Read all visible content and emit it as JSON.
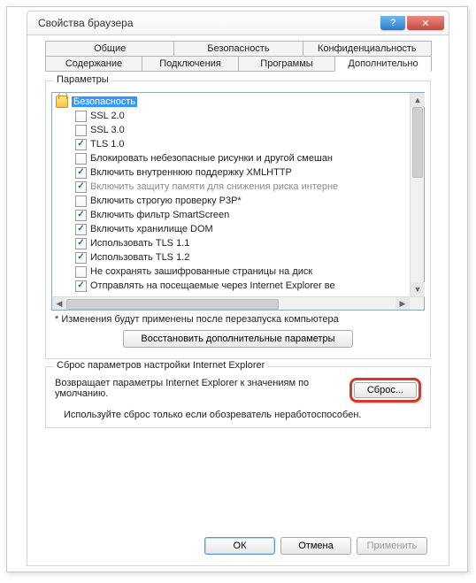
{
  "window": {
    "title": "Свойства браузера",
    "help_glyph": "?",
    "close_glyph": "✕"
  },
  "tabs_row1": [
    {
      "label": "Общие"
    },
    {
      "label": "Безопасность"
    },
    {
      "label": "Конфиденциальность"
    }
  ],
  "tabs_row2": [
    {
      "label": "Содержание"
    },
    {
      "label": "Подключения"
    },
    {
      "label": "Программы"
    },
    {
      "label": "Дополнительно",
      "active": true
    }
  ],
  "params": {
    "legend": "Параметры",
    "category": "Безопасность",
    "items": [
      {
        "label": "SSL 2.0",
        "checked": false
      },
      {
        "label": "SSL 3.0",
        "checked": false
      },
      {
        "label": "TLS 1.0",
        "checked": true
      },
      {
        "label": "Блокировать небезопасные рисунки и другой смешан",
        "checked": false
      },
      {
        "label": "Включить внутреннюю поддержку XMLHTTP",
        "checked": true
      },
      {
        "label": "Включить защиту памяти для снижения риска интерне",
        "checked": true,
        "disabled": true
      },
      {
        "label": "Включить строгую проверку P3P*",
        "checked": false
      },
      {
        "label": "Включить фильтр SmartScreen",
        "checked": true
      },
      {
        "label": "Включить хранилище DOM",
        "checked": true
      },
      {
        "label": "Использовать TLS 1.1",
        "checked": true
      },
      {
        "label": "Использовать TLS 1.2",
        "checked": true
      },
      {
        "label": "Не сохранять зашифрованные страницы на диск",
        "checked": false
      },
      {
        "label": "Отправлять на посещаемые через Internet Explorer ве",
        "checked": true
      }
    ],
    "note": "* Изменения будут применены после перезапуска компьютера",
    "restore_btn": "Восстановить дополнительные параметры"
  },
  "reset": {
    "legend": "Сброс параметров настройки Internet Explorer",
    "text": "Возвращает параметры Internet Explorer к значениям по умолчанию.",
    "btn": "Сброс...",
    "note": "Используйте сброс только если обозреватель неработоспособен."
  },
  "footer": {
    "ok": "ОК",
    "cancel": "Отмена",
    "apply": "Применить"
  }
}
